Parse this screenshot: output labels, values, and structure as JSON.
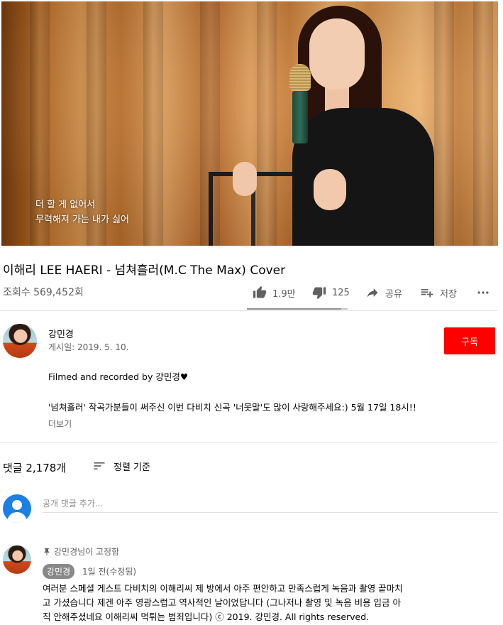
{
  "video": {
    "lyrics": [
      "더 할 게 없어서",
      "무력해져 가는 내가 싫어"
    ]
  },
  "title": "이해리 LEE HAERI - 넘쳐흘러(M.C The Max) Cover",
  "views": "조회수 569,452회",
  "actions": {
    "like_count": "1.9만",
    "dislike_count": "125",
    "share_label": "공유",
    "save_label": "저장",
    "like_ratio": 0.94
  },
  "channel": {
    "name": "강민경",
    "date": "게시일: 2019. 5. 10.",
    "subscribe_label": "구독"
  },
  "description": {
    "line1": "Filmed and recorded by 강민경♥",
    "line2": "'넘쳐흘러' 작곡가분들이 써주신 이번 다비치 신곡 '너못말'도 많이 사랑해주세요:) 5월 17일 18시!!",
    "more_label": "더보기"
  },
  "comments": {
    "count_label": "댓글 2,178개",
    "sort_label": "정렬 기준",
    "input_placeholder": "공개 댓글 추가...",
    "pinned_label": "강민경님이 고정함",
    "author": "강민경",
    "time": "1일 전(수정됨)",
    "text_lines": [
      "여러분 스페셜 게스트 다비치의 이해리씨 제 방에서 아주 편안하고 만족스럽게 녹음과 촬영 끝마치",
      "고 가셨습니다 제겐 아주 영광스럽고 역사적인 날이었답니다 (그나저나 촬영 및 녹음 비용 입금 아",
      "직 안해주셨네요 이해리씨 먹튀는 범죄입니다) ⓒ 2019. 강민경. All rights reserved."
    ]
  },
  "colors": {
    "subscribe": "#ff0000",
    "secondary_text": "#606060",
    "avatar_default": "#1c7fe6"
  }
}
